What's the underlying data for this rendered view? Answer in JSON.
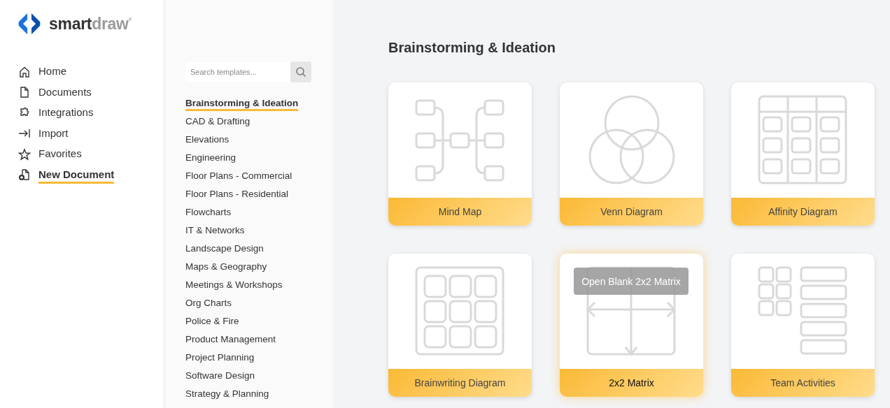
{
  "logo": {
    "first": "smart",
    "second": "draw",
    "mark": "®"
  },
  "nav": [
    {
      "kind": "home",
      "label": "Home",
      "selected": false
    },
    {
      "kind": "documents",
      "label": "Documents",
      "selected": false
    },
    {
      "kind": "integrations",
      "label": "Integrations",
      "selected": false
    },
    {
      "kind": "import",
      "label": "Import",
      "selected": false
    },
    {
      "kind": "favorites",
      "label": "Favorites",
      "selected": false
    },
    {
      "kind": "new-document",
      "label": "New Document",
      "selected": true
    }
  ],
  "search": {
    "placeholder": "Search templates..."
  },
  "categories": [
    {
      "label": "Brainstorming & Ideation",
      "selected": true
    },
    {
      "label": "CAD & Drafting",
      "selected": false
    },
    {
      "label": "Elevations",
      "selected": false
    },
    {
      "label": "Engineering",
      "selected": false
    },
    {
      "label": "Floor Plans - Commercial",
      "selected": false
    },
    {
      "label": "Floor Plans - Residential",
      "selected": false
    },
    {
      "label": "Flowcharts",
      "selected": false
    },
    {
      "label": "IT & Networks",
      "selected": false
    },
    {
      "label": "Landscape Design",
      "selected": false
    },
    {
      "label": "Maps & Geography",
      "selected": false
    },
    {
      "label": "Meetings & Workshops",
      "selected": false
    },
    {
      "label": "Org Charts",
      "selected": false
    },
    {
      "label": "Police & Fire",
      "selected": false
    },
    {
      "label": "Product Management",
      "selected": false
    },
    {
      "label": "Project Planning",
      "selected": false
    },
    {
      "label": "Software Design",
      "selected": false
    },
    {
      "label": "Strategy & Planning",
      "selected": false
    }
  ],
  "heading": "Brainstorming & Ideation",
  "templates": [
    {
      "kind": "mind-map",
      "label": "Mind Map",
      "hovered": false
    },
    {
      "kind": "venn",
      "label": "Venn Diagram",
      "hovered": false
    },
    {
      "kind": "affinity",
      "label": "Affinity Diagram",
      "hovered": false
    },
    {
      "kind": "brainwriting",
      "label": "Brainwriting Diagram",
      "hovered": false
    },
    {
      "kind": "matrix",
      "label": "2x2 Matrix",
      "hovered": true,
      "tooltip": "Open Blank 2x2 Matrix"
    },
    {
      "kind": "team",
      "label": "Team Activities",
      "hovered": false
    }
  ]
}
